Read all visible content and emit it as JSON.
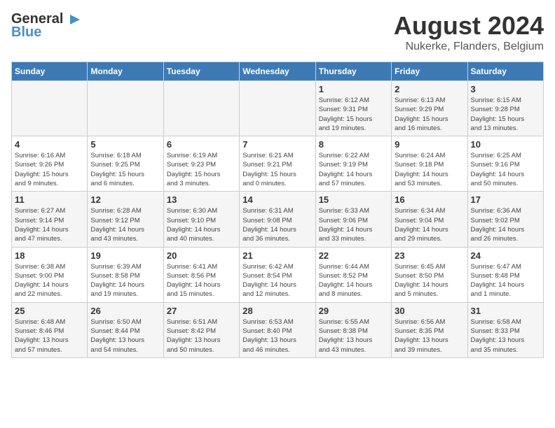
{
  "header": {
    "logo_general": "General",
    "logo_blue": "Blue",
    "month_year": "August 2024",
    "location": "Nukerke, Flanders, Belgium"
  },
  "weekdays": [
    "Sunday",
    "Monday",
    "Tuesday",
    "Wednesday",
    "Thursday",
    "Friday",
    "Saturday"
  ],
  "weeks": [
    [
      {
        "day": "",
        "info": ""
      },
      {
        "day": "",
        "info": ""
      },
      {
        "day": "",
        "info": ""
      },
      {
        "day": "",
        "info": ""
      },
      {
        "day": "1",
        "info": "Sunrise: 6:12 AM\nSunset: 9:31 PM\nDaylight: 15 hours\nand 19 minutes."
      },
      {
        "day": "2",
        "info": "Sunrise: 6:13 AM\nSunset: 9:29 PM\nDaylight: 15 hours\nand 16 minutes."
      },
      {
        "day": "3",
        "info": "Sunrise: 6:15 AM\nSunset: 9:28 PM\nDaylight: 15 hours\nand 13 minutes."
      }
    ],
    [
      {
        "day": "4",
        "info": "Sunrise: 6:16 AM\nSunset: 9:26 PM\nDaylight: 15 hours\nand 9 minutes."
      },
      {
        "day": "5",
        "info": "Sunrise: 6:18 AM\nSunset: 9:25 PM\nDaylight: 15 hours\nand 6 minutes."
      },
      {
        "day": "6",
        "info": "Sunrise: 6:19 AM\nSunset: 9:23 PM\nDaylight: 15 hours\nand 3 minutes."
      },
      {
        "day": "7",
        "info": "Sunrise: 6:21 AM\nSunset: 9:21 PM\nDaylight: 15 hours\nand 0 minutes."
      },
      {
        "day": "8",
        "info": "Sunrise: 6:22 AM\nSunset: 9:19 PM\nDaylight: 14 hours\nand 57 minutes."
      },
      {
        "day": "9",
        "info": "Sunrise: 6:24 AM\nSunset: 9:18 PM\nDaylight: 14 hours\nand 53 minutes."
      },
      {
        "day": "10",
        "info": "Sunrise: 6:25 AM\nSunset: 9:16 PM\nDaylight: 14 hours\nand 50 minutes."
      }
    ],
    [
      {
        "day": "11",
        "info": "Sunrise: 6:27 AM\nSunset: 9:14 PM\nDaylight: 14 hours\nand 47 minutes."
      },
      {
        "day": "12",
        "info": "Sunrise: 6:28 AM\nSunset: 9:12 PM\nDaylight: 14 hours\nand 43 minutes."
      },
      {
        "day": "13",
        "info": "Sunrise: 6:30 AM\nSunset: 9:10 PM\nDaylight: 14 hours\nand 40 minutes."
      },
      {
        "day": "14",
        "info": "Sunrise: 6:31 AM\nSunset: 9:08 PM\nDaylight: 14 hours\nand 36 minutes."
      },
      {
        "day": "15",
        "info": "Sunrise: 6:33 AM\nSunset: 9:06 PM\nDaylight: 14 hours\nand 33 minutes."
      },
      {
        "day": "16",
        "info": "Sunrise: 6:34 AM\nSunset: 9:04 PM\nDaylight: 14 hours\nand 29 minutes."
      },
      {
        "day": "17",
        "info": "Sunrise: 6:36 AM\nSunset: 9:02 PM\nDaylight: 14 hours\nand 26 minutes."
      }
    ],
    [
      {
        "day": "18",
        "info": "Sunrise: 6:38 AM\nSunset: 9:00 PM\nDaylight: 14 hours\nand 22 minutes."
      },
      {
        "day": "19",
        "info": "Sunrise: 6:39 AM\nSunset: 8:58 PM\nDaylight: 14 hours\nand 19 minutes."
      },
      {
        "day": "20",
        "info": "Sunrise: 6:41 AM\nSunset: 8:56 PM\nDaylight: 14 hours\nand 15 minutes."
      },
      {
        "day": "21",
        "info": "Sunrise: 6:42 AM\nSunset: 8:54 PM\nDaylight: 14 hours\nand 12 minutes."
      },
      {
        "day": "22",
        "info": "Sunrise: 6:44 AM\nSunset: 8:52 PM\nDaylight: 14 hours\nand 8 minutes."
      },
      {
        "day": "23",
        "info": "Sunrise: 6:45 AM\nSunset: 8:50 PM\nDaylight: 14 hours\nand 5 minutes."
      },
      {
        "day": "24",
        "info": "Sunrise: 6:47 AM\nSunset: 8:48 PM\nDaylight: 14 hours\nand 1 minute."
      }
    ],
    [
      {
        "day": "25",
        "info": "Sunrise: 6:48 AM\nSunset: 8:46 PM\nDaylight: 13 hours\nand 57 minutes."
      },
      {
        "day": "26",
        "info": "Sunrise: 6:50 AM\nSunset: 8:44 PM\nDaylight: 13 hours\nand 54 minutes."
      },
      {
        "day": "27",
        "info": "Sunrise: 6:51 AM\nSunset: 8:42 PM\nDaylight: 13 hours\nand 50 minutes."
      },
      {
        "day": "28",
        "info": "Sunrise: 6:53 AM\nSunset: 8:40 PM\nDaylight: 13 hours\nand 46 minutes."
      },
      {
        "day": "29",
        "info": "Sunrise: 6:55 AM\nSunset: 8:38 PM\nDaylight: 13 hours\nand 43 minutes."
      },
      {
        "day": "30",
        "info": "Sunrise: 6:56 AM\nSunset: 8:35 PM\nDaylight: 13 hours\nand 39 minutes."
      },
      {
        "day": "31",
        "info": "Sunrise: 6:58 AM\nSunset: 8:33 PM\nDaylight: 13 hours\nand 35 minutes."
      }
    ]
  ]
}
